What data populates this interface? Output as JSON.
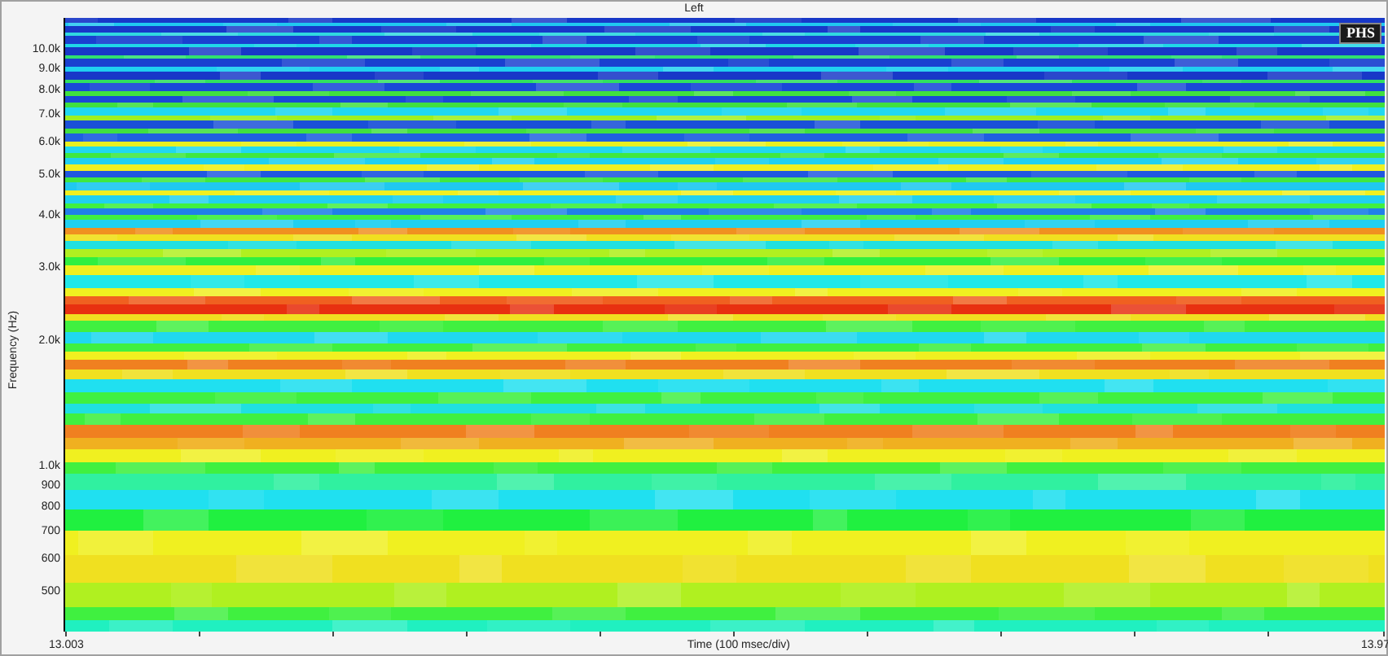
{
  "title": "Left",
  "badge": "PHS",
  "y_axis": {
    "label": "Frequency (Hz)",
    "ticks": [
      "10.0k",
      "9.0k",
      "8.0k",
      "7.0k",
      "6.0k",
      "5.0k",
      "4.0k",
      "3.0k",
      "2.0k",
      "1.0k",
      "900",
      "800",
      "700",
      "600",
      "500"
    ]
  },
  "x_axis": {
    "label": "Time (100 msec/div)",
    "start": "13.003",
    "end": "13.97"
  }
}
